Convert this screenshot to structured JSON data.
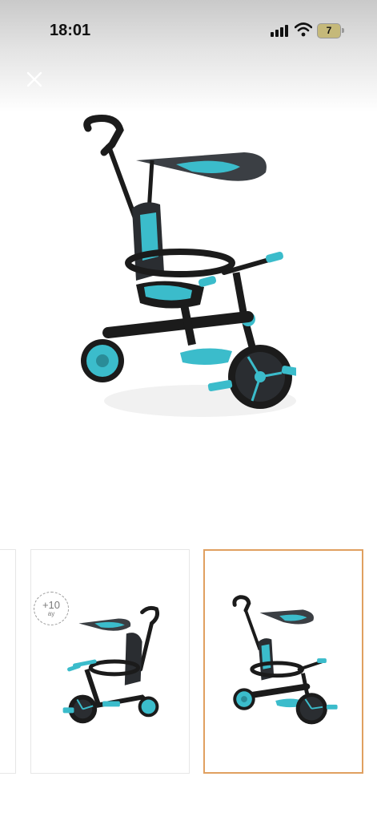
{
  "status_bar": {
    "time": "18:01",
    "battery_level": "7",
    "icons": [
      "cellular-signal-icon",
      "wifi-icon",
      "battery-icon"
    ]
  },
  "viewer": {
    "close_icon": "close-icon",
    "main_image": "teal-black-kids-tricycle-with-canopy-and-push-handle"
  },
  "thumbnails": [
    {
      "image": "partial-previous-thumbnail",
      "selected": false
    },
    {
      "image": "tricycle-front-view",
      "selected": false,
      "age_badge": {
        "value": "+10",
        "unit": "ay"
      }
    },
    {
      "image": "tricycle-side-view",
      "selected": true
    }
  ],
  "colors": {
    "accent_teal": "#3bbccb",
    "frame_black": "#1b1b1b",
    "selected_border": "#e0a060"
  }
}
